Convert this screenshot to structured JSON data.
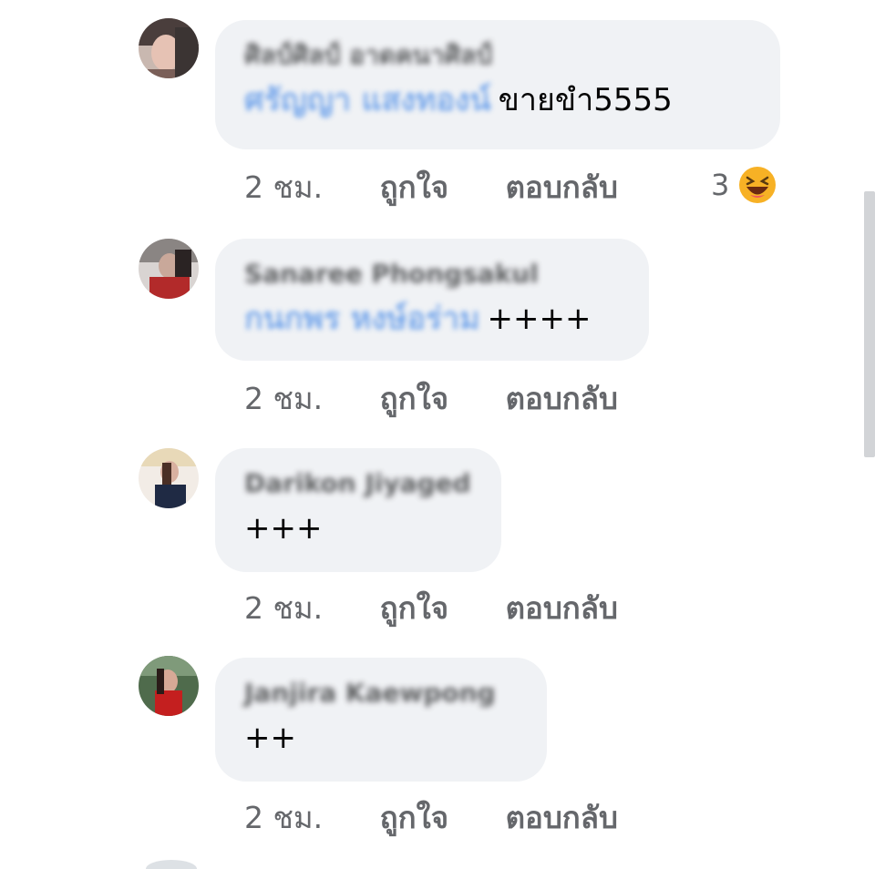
{
  "comments": [
    {
      "author": "ศิลป์ศิลป์ อาดคนาศิลป์",
      "mention": "ศรัญญา แสงทองน์",
      "text": "ขายขำ5555",
      "time": "2 ชม.",
      "like_label": "ถูกใจ",
      "reply_label": "ตอบกลับ",
      "reaction_count": "3",
      "reaction_icon": "laugh-emoji-icon"
    },
    {
      "author": "Sanaree Phongsakul",
      "mention": "กนกพร หงษ์อร่าม",
      "text": "++++",
      "time": "2 ชม.",
      "like_label": "ถูกใจ",
      "reply_label": "ตอบกลับ"
    },
    {
      "author": "Darikon Jiyaged",
      "mention": "",
      "text": "+++",
      "time": "2 ชม.",
      "like_label": "ถูกใจ",
      "reply_label": "ตอบกลับ"
    },
    {
      "author": "Janjira Kaewpong",
      "mention": "",
      "text": "++",
      "time": "2 ชม.",
      "like_label": "ถูกใจ",
      "reply_label": "ตอบกลับ"
    }
  ],
  "colors": {
    "bubble": "#f0f2f5",
    "action_text": "#65676b",
    "mention": "#4f8fe8",
    "emoji_face": "#f7b125"
  }
}
